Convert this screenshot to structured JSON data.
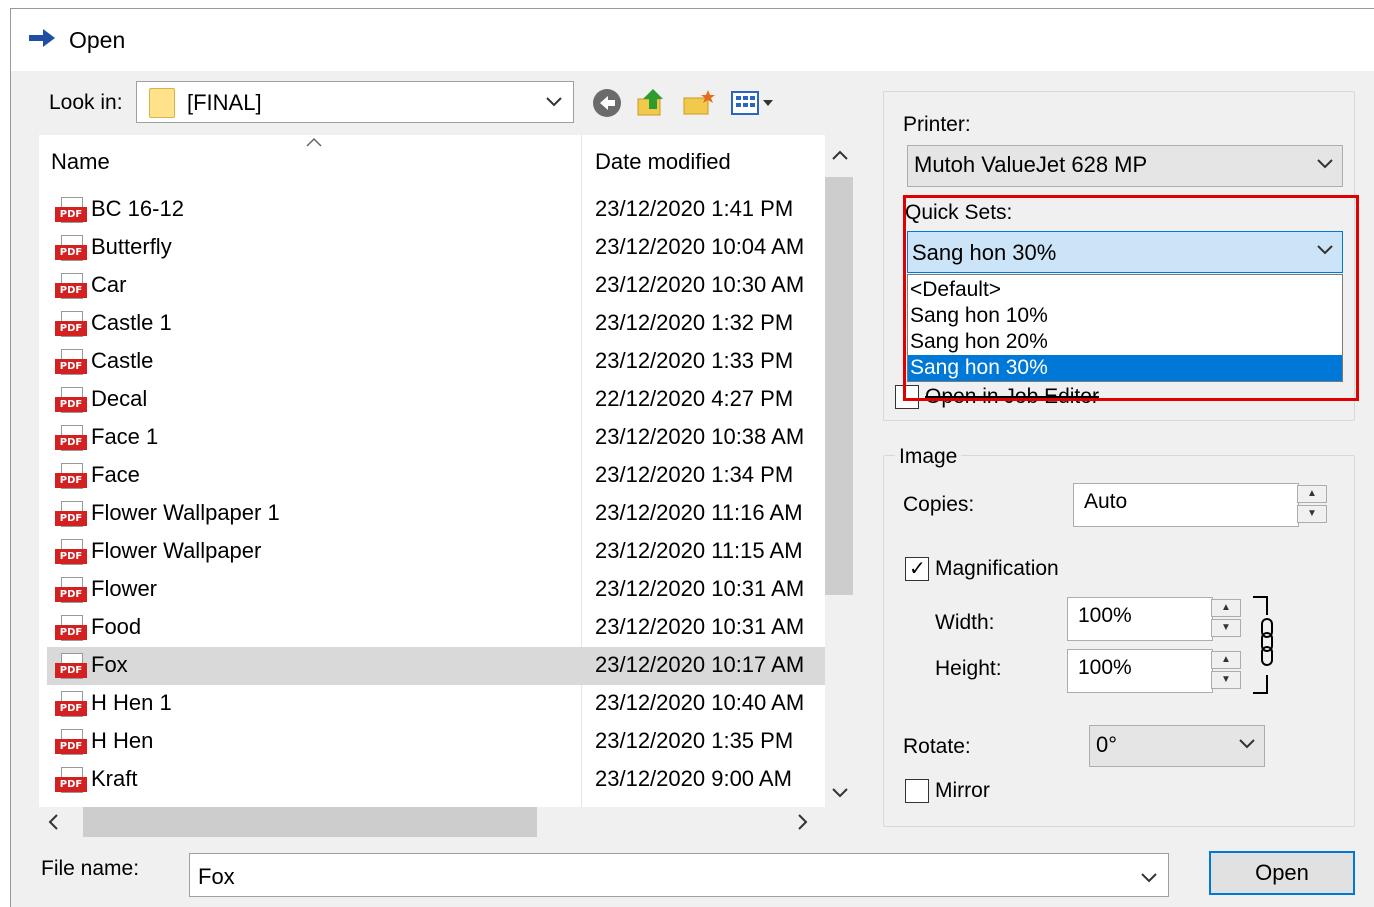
{
  "title": "Open",
  "look_in": {
    "label": "Look in:",
    "value": "[FINAL]"
  },
  "columns": {
    "name": "Name",
    "date": "Date modified"
  },
  "files": [
    {
      "name": "BC 16-12",
      "date": "23/12/2020 1:41 PM"
    },
    {
      "name": "Butterfly",
      "date": "23/12/2020 10:04 AM"
    },
    {
      "name": "Car",
      "date": "23/12/2020 10:30 AM"
    },
    {
      "name": "Castle 1",
      "date": "23/12/2020 1:32 PM"
    },
    {
      "name": "Castle",
      "date": "23/12/2020 1:33 PM"
    },
    {
      "name": "Decal",
      "date": "22/12/2020 4:27 PM"
    },
    {
      "name": "Face 1",
      "date": "23/12/2020 10:38 AM"
    },
    {
      "name": "Face",
      "date": "23/12/2020 1:34 PM"
    },
    {
      "name": "Flower Wallpaper 1",
      "date": "23/12/2020 11:16 AM"
    },
    {
      "name": "Flower Wallpaper",
      "date": "23/12/2020 11:15 AM"
    },
    {
      "name": "Flower",
      "date": "23/12/2020 10:31 AM"
    },
    {
      "name": "Food",
      "date": "23/12/2020 10:31 AM"
    },
    {
      "name": "Fox",
      "date": "23/12/2020 10:17 AM",
      "selected": true
    },
    {
      "name": "H Hen 1",
      "date": "23/12/2020 10:40 AM"
    },
    {
      "name": "H Hen",
      "date": "23/12/2020 1:35 PM"
    },
    {
      "name": "Kraft",
      "date": "23/12/2020 9:00 AM"
    }
  ],
  "file_icon": "PDF",
  "file_name": {
    "label": "File name:",
    "value": "Fox"
  },
  "open_button": "Open",
  "printer": {
    "label": "Printer:",
    "value": "Mutoh ValueJet 628 MP"
  },
  "quick_sets": {
    "label": "Quick Sets:",
    "value": "Sang hon 30%",
    "options": [
      "<Default>",
      "Sang hon 10%",
      "Sang hon 20%",
      "Sang hon 30%"
    ],
    "selected_index": 3
  },
  "open_in_job_editor": "Open in Job Editor",
  "image": {
    "group_label": "Image",
    "copies_label": "Copies:",
    "copies_value": "Auto",
    "magnification_label": "Magnification",
    "magnification_checked": true,
    "width_label": "Width:",
    "width_value": "100%",
    "height_label": "Height:",
    "height_value": "100%",
    "rotate_label": "Rotate:",
    "rotate_value": "0°",
    "mirror_label": "Mirror",
    "mirror_checked": false
  },
  "icons": [
    "arrow-right-icon",
    "folder-icon",
    "back-icon",
    "up-folder-icon",
    "new-folder-icon",
    "view-menu-icon",
    "pdf-file-icon",
    "link-chain-icon"
  ],
  "colors": {
    "selection": "#0078d7",
    "highlight_box": "#e00000",
    "row_selected": "#d9d9d9"
  }
}
